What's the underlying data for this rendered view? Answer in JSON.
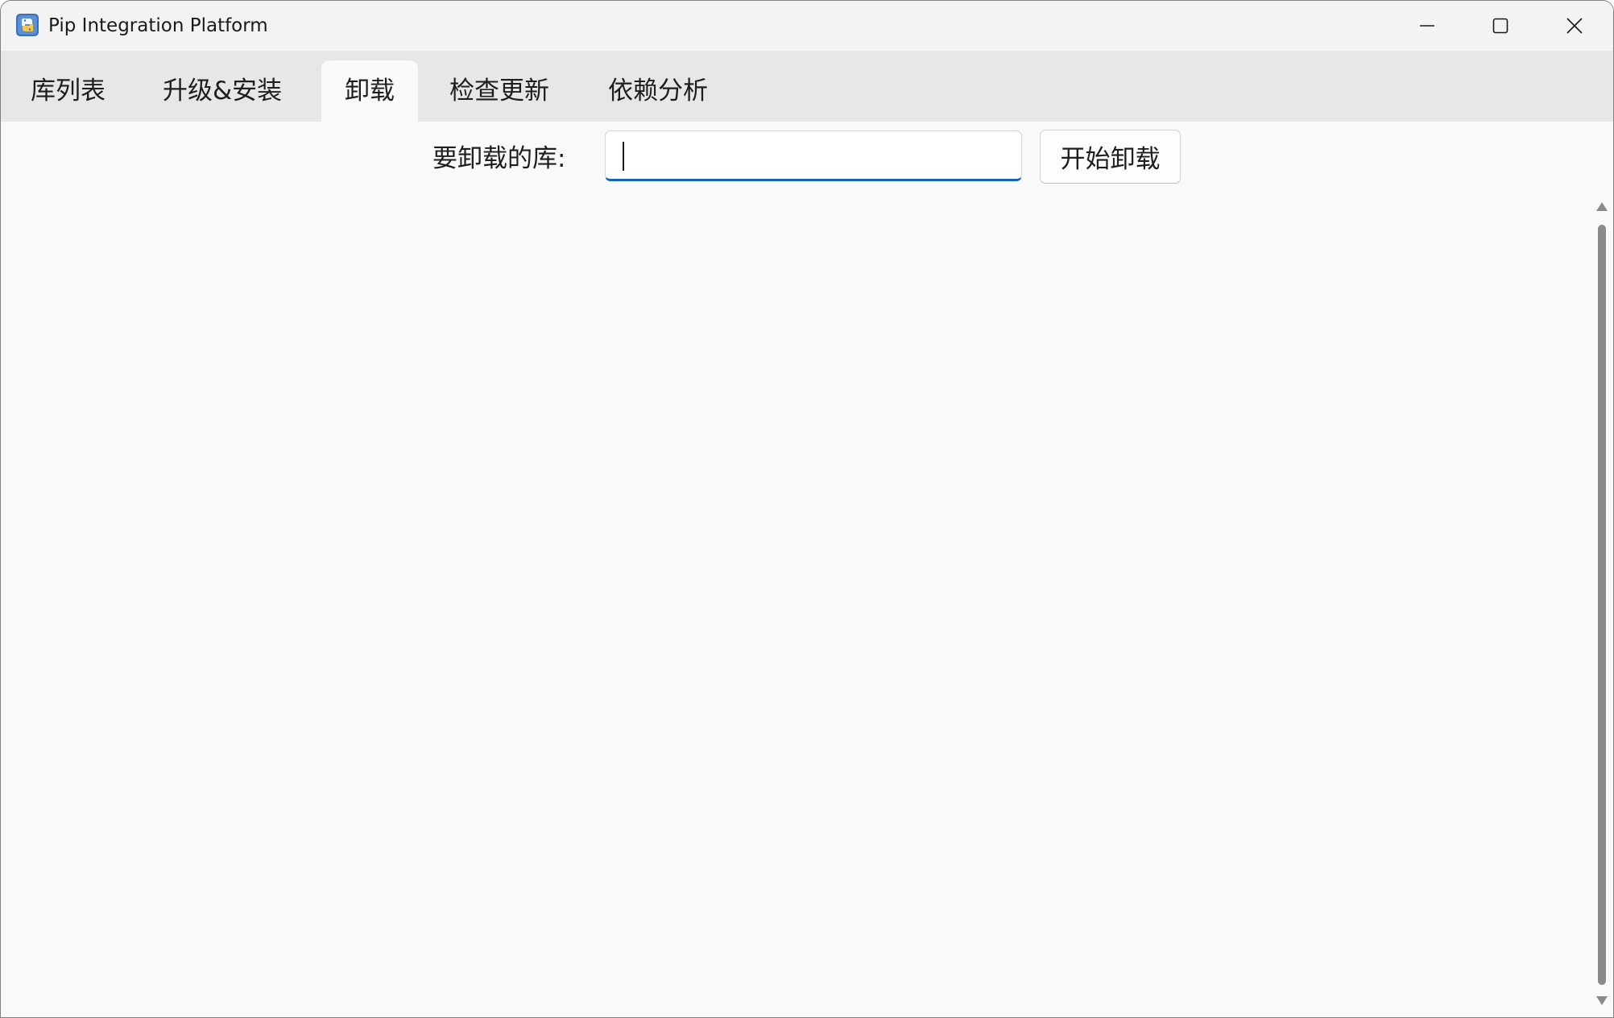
{
  "window": {
    "title": "Pip Integration Platform",
    "controls": {
      "minimize_icon": "minimize-icon",
      "maximize_icon": "maximize-icon",
      "close_icon": "close-icon"
    }
  },
  "tabs": [
    {
      "label": "库列表",
      "active": false
    },
    {
      "label": "升级&安装",
      "active": false
    },
    {
      "label": "卸载",
      "active": true
    },
    {
      "label": "检查更新",
      "active": false
    },
    {
      "label": "依赖分析",
      "active": false
    }
  ],
  "uninstall": {
    "label": "要卸载的库:",
    "input_value": "",
    "button_label": "开始卸载"
  },
  "colors": {
    "input_focus_underline": "#1263b8",
    "tabbar_bg": "#e7e7e7",
    "content_bg": "#f9f9f9",
    "titlebar_bg": "#f3f3f3"
  }
}
